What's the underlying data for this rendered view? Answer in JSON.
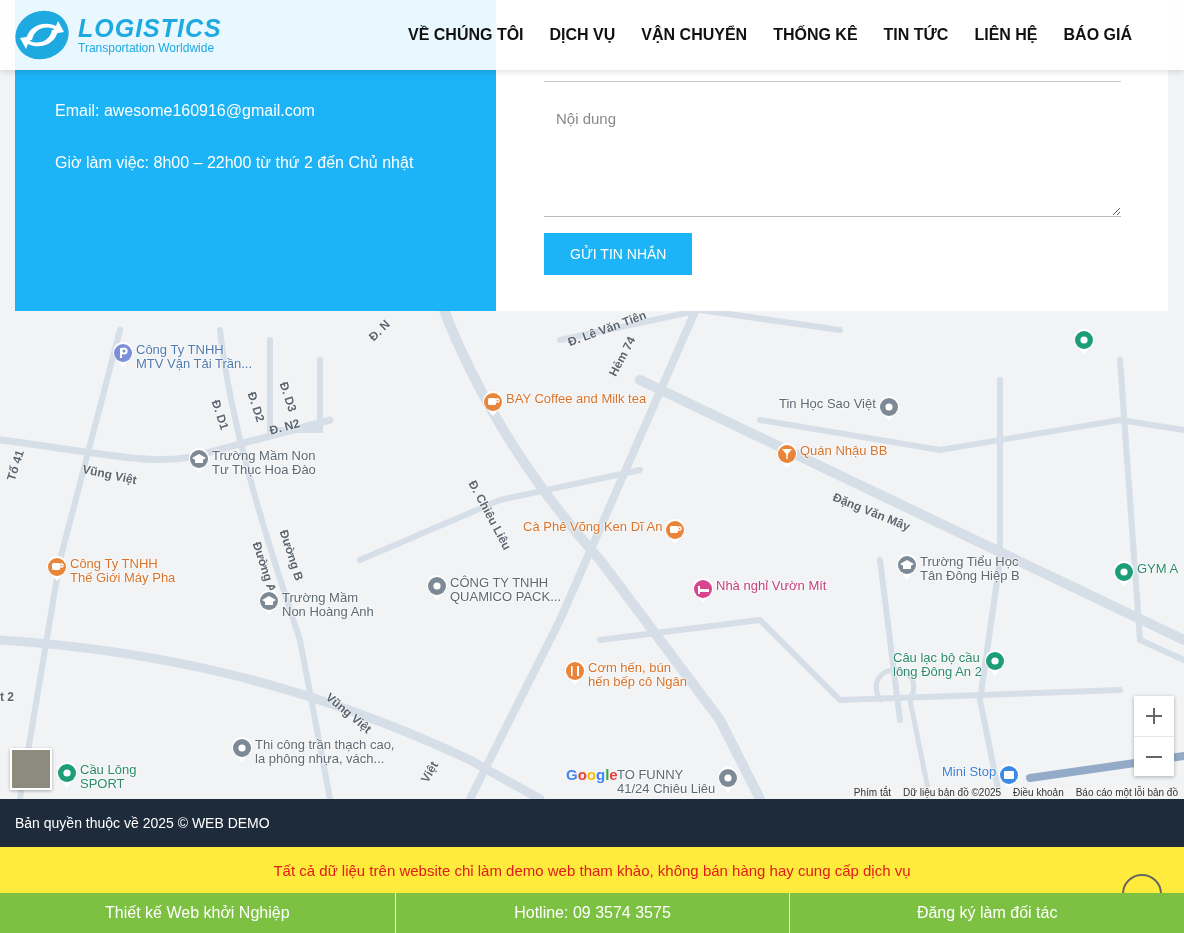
{
  "header": {
    "logo": {
      "name": "LOGISTICS",
      "tagline": "Transportation Worldwide"
    },
    "nav": [
      {
        "label": "VỀ CHÚNG TÔI"
      },
      {
        "label": "DỊCH VỤ"
      },
      {
        "label": "VẬN CHUYỂN"
      },
      {
        "label": "THỐNG KÊ"
      },
      {
        "label": "TIN TỨC"
      },
      {
        "label": "LIÊN HỆ"
      },
      {
        "label": "BÁO GIÁ"
      }
    ]
  },
  "contact_info": [
    "Email: awesome160916@gmail.com",
    "Giờ làm việc: 8h00 – 22h00 từ thứ 2 đến Chủ nhật"
  ],
  "contact_form": {
    "fields": [
      {
        "kind": "input"
      },
      {
        "kind": "textarea",
        "placeholder": "Nội dung"
      }
    ],
    "submit": "GỬI TIN NHẮN"
  },
  "map": {
    "places": [
      {
        "kind": "parking",
        "lines": [
          "Công Ty TNHH",
          "MTV Vận Tải Trần..."
        ]
      },
      {
        "kind": "cafe",
        "lines": [
          "BAY Coffee and Milk tea"
        ]
      },
      {
        "kind": "school",
        "lines": [
          "Trường Mầm Non",
          "Tư Thục Hoa Đào"
        ]
      },
      {
        "kind": "business",
        "lines": [
          "Tin Học Sao Việt"
        ]
      },
      {
        "kind": "bar",
        "lines": [
          "Quán Nhậu BB"
        ]
      },
      {
        "kind": "cafe",
        "lines": [
          "Công Ty TNHH",
          "Thế Giới Máy Pha"
        ]
      },
      {
        "kind": "cafe",
        "lines": [
          "Cà Phê Võng Ken Dĩ An"
        ]
      },
      {
        "kind": "school",
        "lines": [
          "Trường Tiểu Học",
          "Tân Đông Hiệp B"
        ]
      },
      {
        "kind": "sport",
        "lines": [
          "GYM A"
        ]
      },
      {
        "kind": "business",
        "lines": [
          "CÔNG TY TNHH",
          "QUAMICO PACK..."
        ]
      },
      {
        "kind": "lodging",
        "lines": [
          "Nhà nghỉ Vườn Mít"
        ]
      },
      {
        "kind": "school",
        "lines": [
          "Trường Mầm",
          "Non Hoàng Anh"
        ]
      },
      {
        "kind": "restaurant",
        "lines": [
          "Cơm hến, bún",
          "hến bếp cô Ngân"
        ]
      },
      {
        "kind": "sport",
        "lines": [
          "Câu lạc bộ cầu",
          "lông Đông An 2"
        ]
      },
      {
        "kind": "business",
        "lines": [
          "Thi công trần thạch cao,",
          "la phông nhựa, vách..."
        ]
      },
      {
        "kind": "sport",
        "lines": [
          "Cầu Lông",
          "SPORT"
        ]
      },
      {
        "kind": "business",
        "lines": [
          "TO FUNNY",
          "41/24 Chiêu Liêu"
        ]
      },
      {
        "kind": "shop",
        "lines": [
          "Mini Stop"
        ]
      },
      {
        "kind": "sport"
      }
    ],
    "streets": [
      "Đ. D1",
      "Đ. D2",
      "Đ. D3",
      "Đ. N2",
      "Vũng Việt",
      "Tổ 41",
      "Đường A",
      "Đường B",
      "Đ. Chiêu Liêu",
      "Hẻm 74",
      "Đặng Văn Mây",
      "Vũng Việt",
      "Việt",
      "Đ. Lê Văn Tiên",
      "Đ. N",
      "t 2"
    ],
    "logo": "Google",
    "attribution": [
      "Phím tắt",
      "Dữ liệu bản đồ ©2025",
      "Điều khoản",
      "Báo cáo một lỗi bản đồ"
    ]
  },
  "footer": {
    "copyright": "Bản quyền thuộc về 2025 © WEB DEMO",
    "notice": "Tất cả dữ liệu trên website chỉ làm demo web tham khảo, không bán hàng hay cung cấp dịch vụ",
    "links": [
      "Thiết kế Web khởi Nghiệp",
      "Hotline: 09 3574 3575",
      "Đăng ký làm đối tác"
    ]
  }
}
